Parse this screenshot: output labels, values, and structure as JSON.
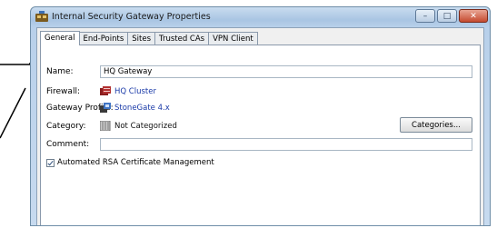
{
  "window": {
    "title": "Internal Security Gateway Properties",
    "buttons": {
      "minimize": "–",
      "maximize": "□",
      "close": "✕"
    }
  },
  "tabs": [
    {
      "label": "General",
      "active": true
    },
    {
      "label": "End-Points",
      "active": false
    },
    {
      "label": "Sites",
      "active": false
    },
    {
      "label": "Trusted CAs",
      "active": false
    },
    {
      "label": "VPN Client",
      "active": false
    }
  ],
  "form": {
    "name": {
      "label": "Name:",
      "value": "HQ Gateway"
    },
    "firewall": {
      "label": "Firewall:",
      "value": "HQ Cluster",
      "icon": "firewall-cluster-icon"
    },
    "gateway_profile": {
      "label": "Gateway Profile:",
      "value": "StoneGate 4.x",
      "icon": "gateway-profile-icon"
    },
    "category": {
      "label": "Category:",
      "value": "Not Categorized",
      "icon": "category-icon",
      "button": "Categories..."
    },
    "comment": {
      "label": "Comment:",
      "value": ""
    },
    "rsa_checkbox": {
      "label": "Automated RSA Certificate Management",
      "checked": true
    }
  },
  "colors": {
    "link": "#1a3aa8",
    "callout": "#000000"
  }
}
